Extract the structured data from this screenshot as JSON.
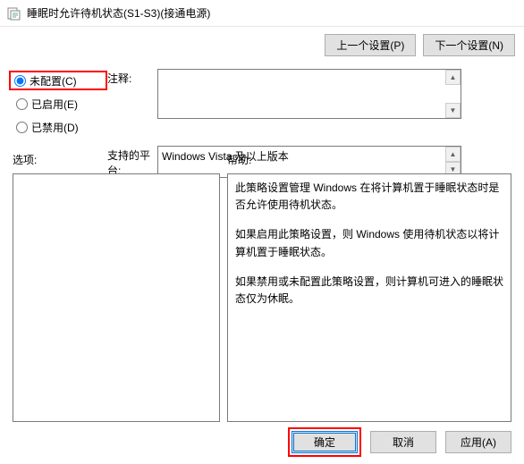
{
  "window": {
    "title": "睡眠时允许待机状态(S1-S3)(接通电源)"
  },
  "nav": {
    "prev": "上一个设置(P)",
    "next": "下一个设置(N)"
  },
  "radios": {
    "not_configured": "未配置(C)",
    "enabled": "已启用(E)",
    "disabled": "已禁用(D)"
  },
  "labels": {
    "comment": "注释:",
    "platform": "支持的平台:",
    "options": "选项:",
    "help": "帮助:"
  },
  "platform_text": "Windows Vista 及以上版本",
  "help": {
    "p1": "此策略设置管理 Windows 在将计算机置于睡眠状态时是否允许使用待机状态。",
    "p2": "如果启用此策略设置，则 Windows 使用待机状态以将计算机置于睡眠状态。",
    "p3": "如果禁用或未配置此策略设置，则计算机可进入的睡眠状态仅为休眠。"
  },
  "buttons": {
    "ok": "确定",
    "cancel": "取消",
    "apply": "应用(A)"
  }
}
